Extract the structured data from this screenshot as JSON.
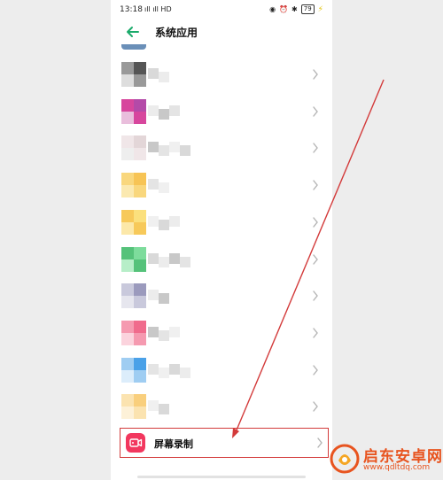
{
  "status_bar": {
    "time": "13:18",
    "signal": "ıll ıll HD",
    "battery": "79"
  },
  "header": {
    "title": "系统应用"
  },
  "list": {
    "rows": [
      {
        "icon_colors": [
          "#555555",
          "#999999",
          "#dddddd"
        ]
      },
      {
        "icon_colors": [
          "#b44aa8",
          "#d7469d",
          "#e9bedc"
        ]
      },
      {
        "icon_colors": [
          "#e3d6d8",
          "#f0e6e8",
          "#eeeeee"
        ]
      },
      {
        "icon_colors": [
          "#f7c455",
          "#f9d77d",
          "#fbe9b0"
        ]
      },
      {
        "icon_colors": [
          "#fbe07d",
          "#f7c95a",
          "#fce8a9"
        ]
      },
      {
        "icon_colors": [
          "#7ddc9c",
          "#55c27a",
          "#b7eec8"
        ]
      },
      {
        "icon_colors": [
          "#9b9abd",
          "#c9c9dc",
          "#e6e6ee"
        ]
      },
      {
        "icon_colors": [
          "#f06b8c",
          "#f59ab0",
          "#fbd3dd"
        ]
      },
      {
        "icon_colors": [
          "#4aa1e8",
          "#9fcdf2",
          "#dcedfb"
        ]
      },
      {
        "icon_colors": [
          "#f9cf7d",
          "#fbe3b0",
          "#fdf1d8"
        ]
      }
    ],
    "highlighted": {
      "label": "屏幕录制",
      "accent": "#f2375e"
    }
  },
  "annotation": {
    "arrow_color": "#d33a3a"
  },
  "watermark": {
    "name": "启东安卓网",
    "url": "www.qdltdq.com",
    "color": "#e8541f"
  }
}
